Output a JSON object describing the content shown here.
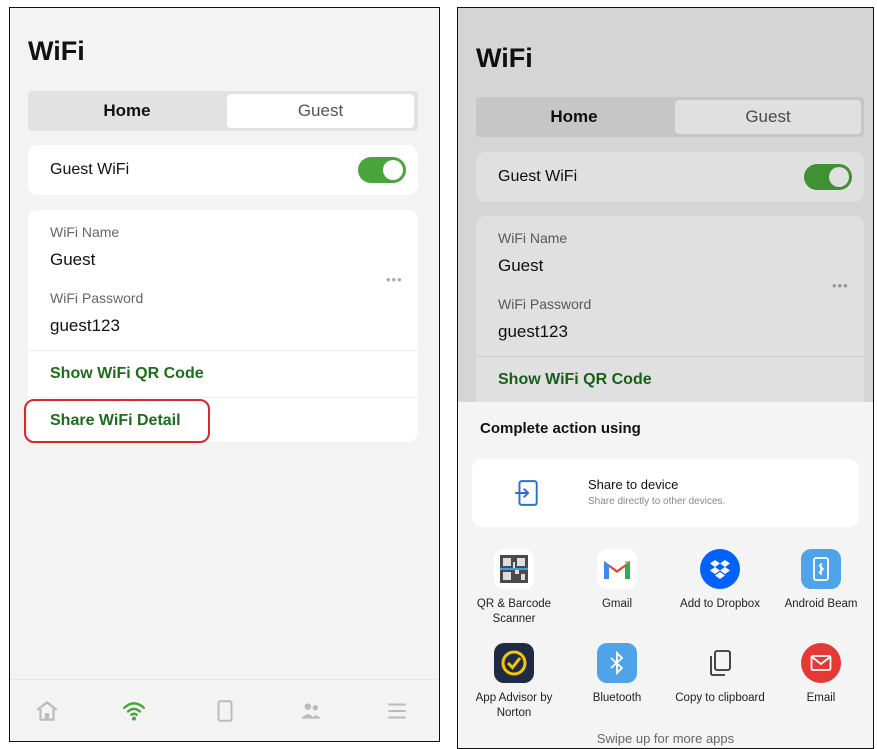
{
  "left": {
    "title": "WiFi",
    "tabs": [
      {
        "label": "Home"
      },
      {
        "label": "Guest"
      }
    ],
    "guest_wifi": {
      "label": "Guest WiFi",
      "enabled": true
    },
    "wifi_name": {
      "label": "WiFi Name",
      "value": "Guest"
    },
    "wifi_password": {
      "label": "WiFi Password",
      "value": "guest123"
    },
    "more": "•••",
    "show_qr": "Show WiFi QR Code",
    "share_detail": "Share WiFi Detail",
    "nav": [
      "home-icon",
      "wifi-icon",
      "device-icon",
      "users-icon",
      "menu-icon"
    ]
  },
  "right": {
    "title": "WiFi",
    "tabs": [
      {
        "label": "Home"
      },
      {
        "label": "Guest"
      }
    ],
    "guest_wifi": {
      "label": "Guest WiFi",
      "enabled": true
    },
    "wifi_name": {
      "label": "WiFi Name",
      "value": "Guest"
    },
    "wifi_password": {
      "label": "WiFi Password",
      "value": "guest123"
    },
    "more": "•••",
    "show_qr": "Show WiFi QR Code",
    "sheet": {
      "title": "Complete action using",
      "share_device": {
        "title": "Share to device",
        "subtitle": "Share directly to other devices."
      },
      "apps": [
        {
          "label": "QR & Barcode Scanner",
          "icon": "qr-scanner-icon"
        },
        {
          "label": "Gmail",
          "icon": "gmail-icon"
        },
        {
          "label": "Add to Dropbox",
          "icon": "dropbox-icon"
        },
        {
          "label": "Android Beam",
          "icon": "android-beam-icon"
        },
        {
          "label": "App Advisor by Norton",
          "icon": "norton-icon"
        },
        {
          "label": "Bluetooth",
          "icon": "bluetooth-icon"
        },
        {
          "label": "Copy to clipboard",
          "icon": "clipboard-icon"
        },
        {
          "label": "Email",
          "icon": "email-icon"
        }
      ],
      "swipe_hint": "Swipe up for more apps"
    }
  },
  "colors": {
    "accent_green": "#1d6d1d",
    "toggle_green": "#4aa43c",
    "highlight_red": "#d9272e"
  }
}
